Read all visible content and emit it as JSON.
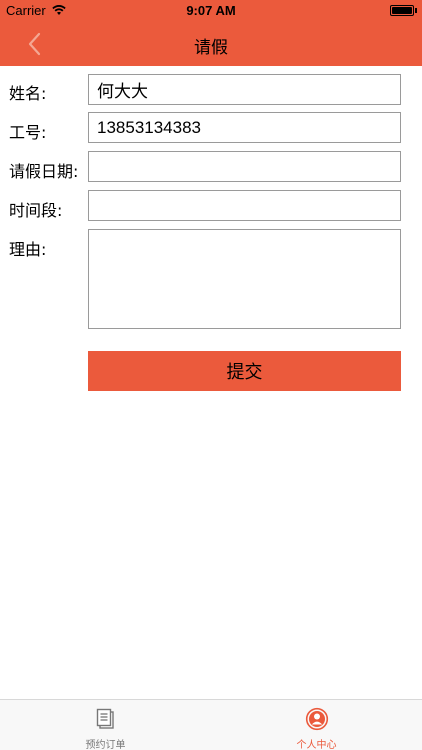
{
  "status_bar": {
    "carrier": "Carrier",
    "time": "9:07 AM"
  },
  "nav": {
    "title": "请假",
    "back_icon": "chevron-left-icon"
  },
  "form": {
    "name_label": "姓名:",
    "name_value": "何大大",
    "id_label": "工号:",
    "id_value": "13853134383",
    "date_label": "请假日期:",
    "date_value": "",
    "period_label": "时间段:",
    "period_value": "",
    "reason_label": "理由:",
    "reason_value": "",
    "submit_label": "提交"
  },
  "tab_bar": {
    "tabs": [
      {
        "label": "预约订单",
        "icon": "document-list-icon",
        "active": false
      },
      {
        "label": "个人中心",
        "icon": "user-circle-icon",
        "active": true
      }
    ]
  },
  "colors": {
    "accent": "#EB5A3C",
    "tab_inactive": "#777777",
    "field_border": "#9a9a9a"
  }
}
